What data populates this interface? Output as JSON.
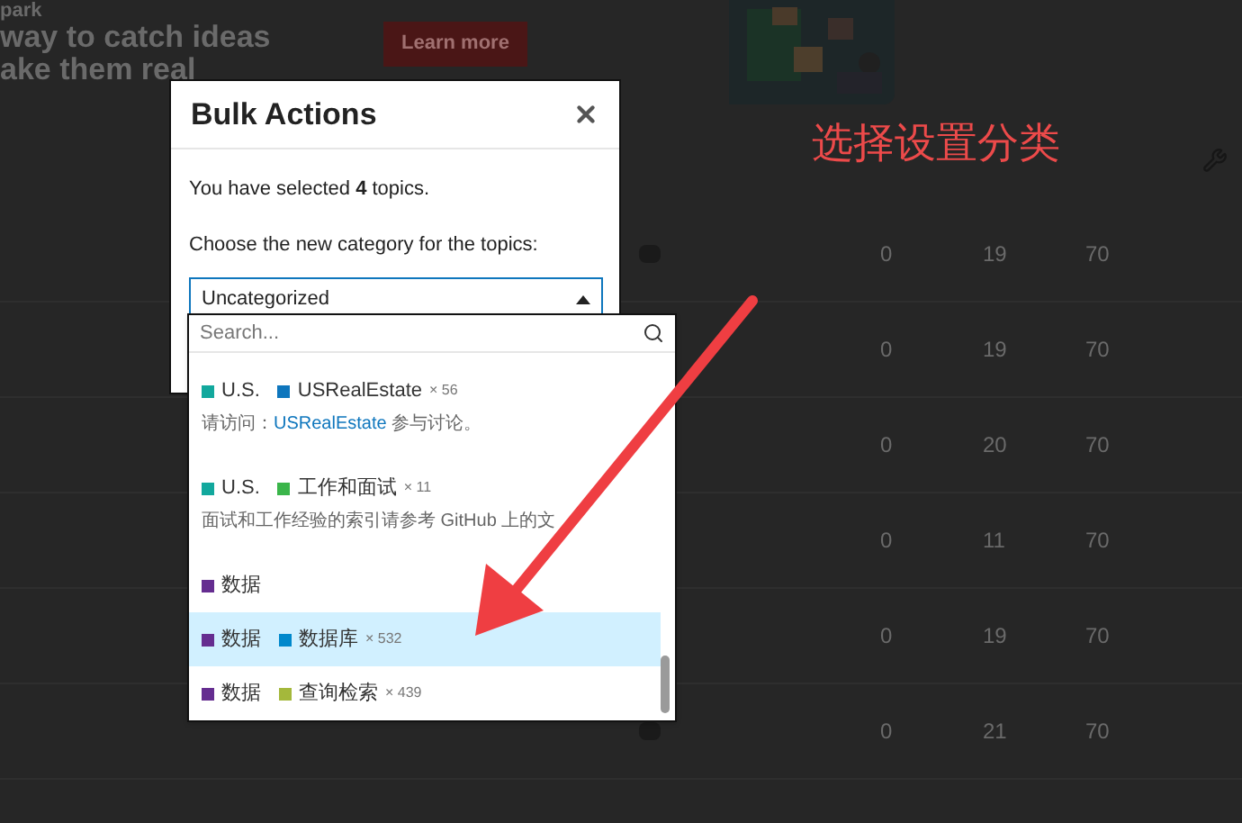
{
  "banner": {
    "brand": "park",
    "headline": [
      "way to catch ideas",
      "ake them real"
    ],
    "button": "Learn more"
  },
  "topic_rows": [
    {
      "values": [
        "0",
        "19",
        "70"
      ],
      "icon": true
    },
    {
      "values": [
        "0",
        "19",
        "70"
      ]
    },
    {
      "values": [
        "0",
        "20",
        "70"
      ]
    },
    {
      "values": [
        "0",
        "11",
        "70"
      ]
    },
    {
      "values": [
        "0",
        "19",
        "70"
      ]
    },
    {
      "values": [
        "0",
        "21",
        "70"
      ],
      "icon": true
    }
  ],
  "modal": {
    "title": "Bulk Actions",
    "message": "You have selected **4** topics.",
    "prompt": "Choose the new category for the topics:",
    "select": {
      "value": "Uncategorized",
      "expanded": true,
      "search": {
        "placeholder": "Search..."
      },
      "options": [
        {
          "parent": {
            "name": "U.S.",
            "color": "#12a89d"
          },
          "category": {
            "name": "USRealEstate",
            "color": "#0e76bd"
          },
          "count": "× 56",
          "desc_before": "请访问：",
          "desc_link": "USRealEstate",
          "desc_after": " 参与讨论。",
          "selected": false
        },
        {
          "parent": {
            "name": "U.S.",
            "color": "#12a89d"
          },
          "category": {
            "name": "工作和面试",
            "color": "#3ab54a"
          },
          "count": "× 11",
          "desc_before": "面试和工作经验的索引请参考 GitHub 上的文",
          "selected": false
        },
        {
          "parent": {
            "name": "数据",
            "color": "#652d90"
          },
          "selected": false
        },
        {
          "parent": {
            "name": "数据",
            "color": "#652d90"
          },
          "category": {
            "name": "数据库",
            "color": "#0088cc"
          },
          "count": "× 532",
          "selected": true
        },
        {
          "parent": {
            "name": "数据",
            "color": "#652d90"
          },
          "category": {
            "name": "查询检索",
            "color": "#a4b83b"
          },
          "count": "× 439",
          "selected": false
        }
      ]
    }
  },
  "annotation": {
    "text": "选择设置分类"
  }
}
